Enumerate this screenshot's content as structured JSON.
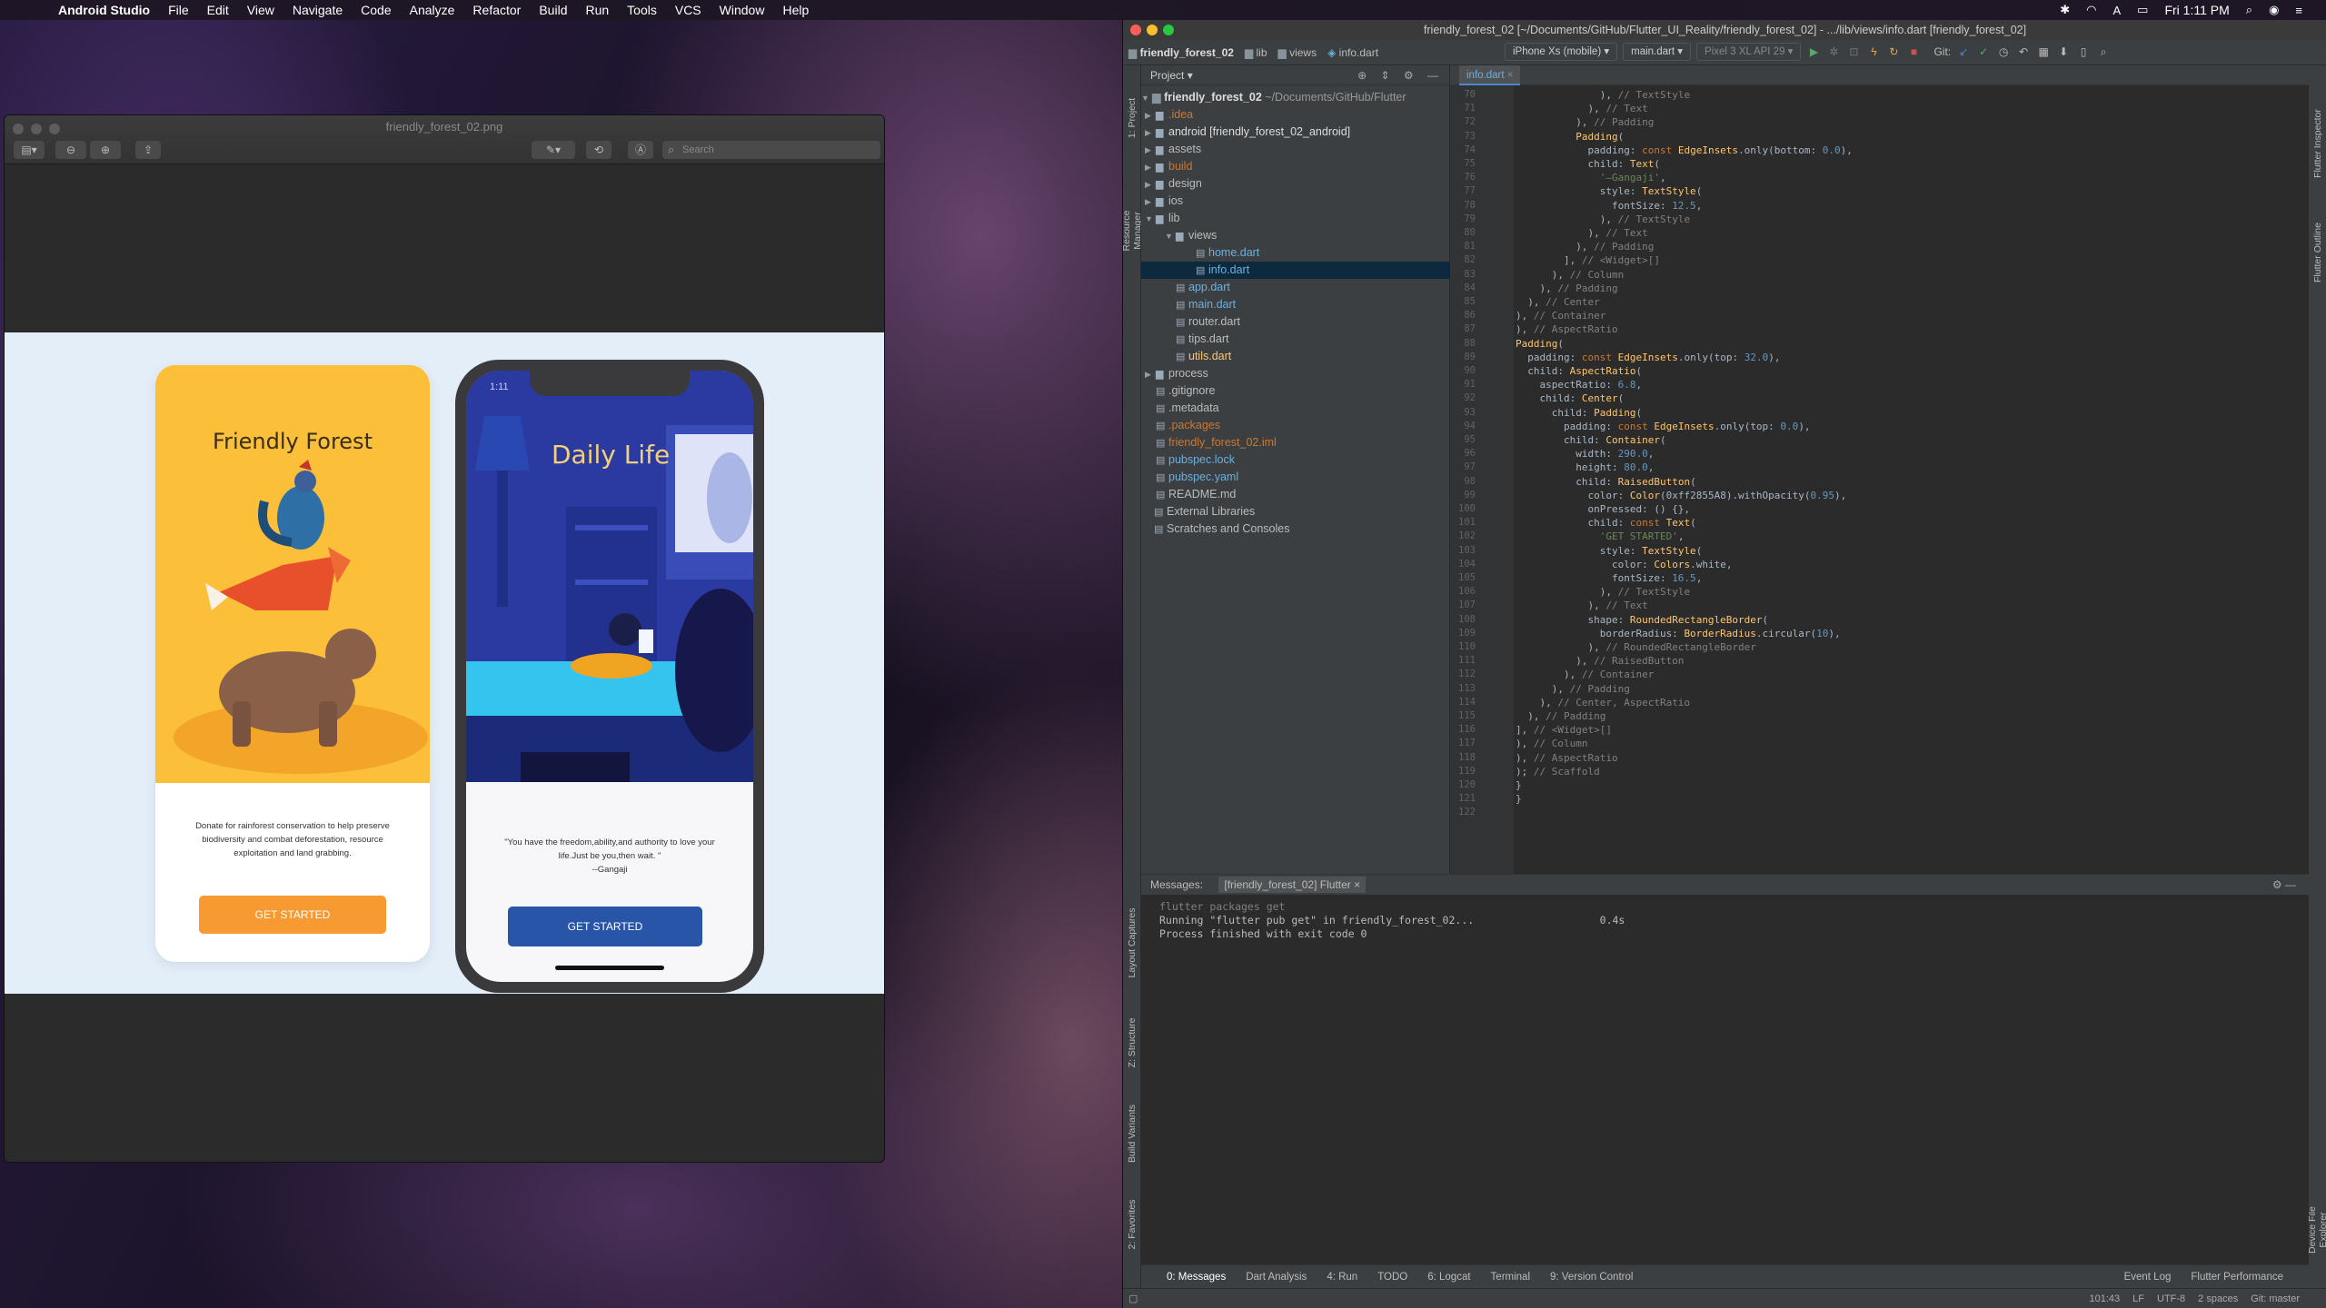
{
  "menubar": {
    "app": "Android Studio",
    "items": [
      "File",
      "Edit",
      "View",
      "Navigate",
      "Code",
      "Analyze",
      "Refactor",
      "Build",
      "Run",
      "Tools",
      "VCS",
      "Window",
      "Help"
    ],
    "clock": "Fri 1:11 PM"
  },
  "preview": {
    "title": "friendly_forest_02.png",
    "search_placeholder": "Search",
    "card": {
      "title": "Friendly Forest",
      "body": "Donate for rainforest conservation to help preserve biodiversity and combat deforestation, resource exploitation and land grabbing.",
      "button": "GET STARTED"
    },
    "phone": {
      "time": "1:11",
      "title": "Daily Life",
      "quote": "\"You have the freedom,ability,and authority to love your life.Just be you,then wait. \"",
      "author": "--Gangaji",
      "button": "GET STARTED"
    }
  },
  "ide": {
    "title": "friendly_forest_02 [~/Documents/GitHub/Flutter_UI_Reality/friendly_forest_02] - .../lib/views/info.dart [friendly_forest_02]",
    "breadcrumbs": [
      "friendly_forest_02",
      "lib",
      "views",
      "info.dart"
    ],
    "device": "iPhone Xs (mobile)",
    "config": "main.dart",
    "emulator": "Pixel 3 XL API 29",
    "git": "Git:",
    "project_label": "Project",
    "root": "friendly_forest_02",
    "root_path": "~/Documents/GitHub/Flutter",
    "tree": [
      {
        "label": ".idea",
        "depth": 0,
        "arrow": "▶",
        "color": "#cc7832"
      },
      {
        "label": "android [friendly_forest_02_android]",
        "depth": 0,
        "arrow": "▶",
        "color": "#ddd"
      },
      {
        "label": "assets",
        "depth": 0,
        "arrow": "▶",
        "color": "#bbb"
      },
      {
        "label": "build",
        "depth": 0,
        "arrow": "▶",
        "color": "#cc7832"
      },
      {
        "label": "design",
        "depth": 0,
        "arrow": "▶",
        "color": "#bbb"
      },
      {
        "label": "ios",
        "depth": 0,
        "arrow": "▶",
        "color": "#bbb"
      },
      {
        "label": "lib",
        "depth": 0,
        "arrow": "▼",
        "color": "#bbb"
      },
      {
        "label": "views",
        "depth": 1,
        "arrow": "▼",
        "color": "#bbb"
      },
      {
        "label": "home.dart",
        "depth": 2,
        "arrow": "",
        "color": "#6ab0de"
      },
      {
        "label": "info.dart",
        "depth": 2,
        "arrow": "",
        "color": "#6ab0de"
      },
      {
        "label": "app.dart",
        "depth": 1,
        "arrow": "",
        "color": "#6ab0de"
      },
      {
        "label": "main.dart",
        "depth": 1,
        "arrow": "",
        "color": "#6ab0de"
      },
      {
        "label": "router.dart",
        "depth": 1,
        "arrow": "",
        "color": "#bbb"
      },
      {
        "label": "tips.dart",
        "depth": 1,
        "arrow": "",
        "color": "#bbb"
      },
      {
        "label": "utils.dart",
        "depth": 1,
        "arrow": "",
        "color": "#ffc66d"
      },
      {
        "label": "process",
        "depth": 0,
        "arrow": "▶",
        "color": "#bbb"
      },
      {
        "label": ".gitignore",
        "depth": 0,
        "arrow": "",
        "color": "#bbb"
      },
      {
        "label": ".metadata",
        "depth": 0,
        "arrow": "",
        "color": "#bbb"
      },
      {
        "label": ".packages",
        "depth": 0,
        "arrow": "",
        "color": "#cc7832"
      },
      {
        "label": "friendly_forest_02.iml",
        "depth": 0,
        "arrow": "",
        "color": "#cc7832"
      },
      {
        "label": "pubspec.lock",
        "depth": 0,
        "arrow": "",
        "color": "#6ab0de"
      },
      {
        "label": "pubspec.yaml",
        "depth": 0,
        "arrow": "",
        "color": "#6ab0de"
      },
      {
        "label": "README.md",
        "depth": 0,
        "arrow": "",
        "color": "#bbb"
      },
      {
        "label": "External Libraries",
        "depth": -1,
        "arrow": "",
        "color": "#bbb"
      },
      {
        "label": "Scratches and Consoles",
        "depth": -1,
        "arrow": "",
        "color": "#bbb"
      }
    ],
    "tab": "info.dart",
    "first_line": 70,
    "code": [
      "              ), // TextStyle",
      "            ), // Text",
      "          ), // Padding",
      "          Padding(",
      "            padding: const EdgeInsets.only(bottom: 0.0),",
      "            child: Text(",
      "              '—Gangaji',",
      "              style: TextStyle(",
      "                fontSize: 12.5,",
      "              ), // TextStyle",
      "            ), // Text",
      "          ), // Padding",
      "        ], // <Widget>[]",
      "      ), // Column",
      "    ), // Padding",
      "  ), // Center",
      "), // Container",
      "), // AspectRatio",
      "Padding(",
      "  padding: const EdgeInsets.only(top: 32.0),",
      "  child: AspectRatio(",
      "    aspectRatio: 6.8,",
      "    child: Center(",
      "      child: Padding(",
      "        padding: const EdgeInsets.only(top: 0.0),",
      "        child: Container(",
      "          width: 290.0,",
      "          height: 80.0,",
      "          child: RaisedButton(",
      "            color: Color(0xff2855A8).withOpacity(0.95),",
      "            onPressed: () {},",
      "            child: const Text(",
      "              'GET STARTED',",
      "              style: TextStyle(",
      "                color: Colors.white,",
      "                fontSize: 16.5,",
      "              ), // TextStyle",
      "            ), // Text",
      "            shape: RoundedRectangleBorder(",
      "              borderRadius: BorderRadius.circular(10),",
      "            ), // RoundedRectangleBorder",
      "          ), // RaisedButton",
      "        ), // Container",
      "      ), // Padding",
      "    ), // Center, AspectRatio",
      "  ), // Padding",
      "], // <Widget>[]",
      "), // Column",
      "), // AspectRatio",
      "); // Scaffold",
      "}",
      "}",
      ""
    ],
    "messages": {
      "tab_label": "Messages:",
      "tab": "[friendly_forest_02] Flutter",
      "lines": [
        "flutter packages get",
        "Running \"flutter pub get\" in friendly_forest_02...                    0.4s",
        "Process finished with exit code 0"
      ]
    },
    "bottom_tabs": [
      "0: Messages",
      "Dart Analysis",
      "4: Run",
      "TODO",
      "6: Logcat",
      "Terminal",
      "9: Version Control"
    ],
    "left_tools": [
      "1: Project",
      "Resource Manager",
      "Layout Captures",
      "Z: Structure",
      "Build Variants",
      "2: Favorites"
    ],
    "right_tools": [
      "Flutter Inspector",
      "Flutter Outline",
      "Device File Explorer"
    ],
    "status": {
      "event_log": "Event Log",
      "flutter_perf": "Flutter Performance",
      "position": "101:43",
      "line_sep": "LF",
      "encoding": "UTF-8",
      "indent": "2 spaces",
      "git": "Git: master"
    }
  }
}
